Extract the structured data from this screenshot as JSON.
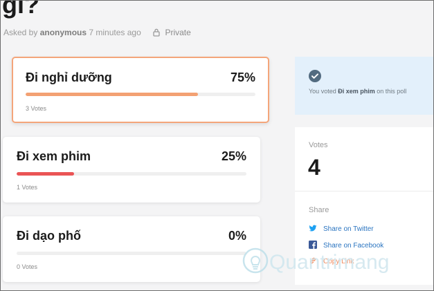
{
  "question": {
    "title": "gì?"
  },
  "meta": {
    "asked_prefix": "Asked by ",
    "author": "anonymous",
    "time": "7 minutes ago",
    "privacy": "Private"
  },
  "options": [
    {
      "label": "Đi nghỉ dưỡng",
      "percent_text": "75%",
      "percent": 75,
      "votes_text": "3 Votes",
      "bar_color": "#f3a173",
      "selected": true
    },
    {
      "label": "Đi xem phim",
      "percent_text": "25%",
      "percent": 25,
      "votes_text": "1 Votes",
      "bar_color": "#ea5455",
      "selected": false
    },
    {
      "label": "Đi dạo phố",
      "percent_text": "0%",
      "percent": 0,
      "votes_text": "0 Votes",
      "bar_color": "#efefef",
      "selected": false
    }
  ],
  "voted": {
    "prefix": "You voted ",
    "choice": "Đi xem phim",
    "suffix": " on this poll"
  },
  "stats": {
    "votes_label": "Votes",
    "votes_count": "4"
  },
  "share": {
    "label": "Share",
    "twitter": "Share on Twitter",
    "facebook": "Share on Facebook",
    "copy": "Copy Link"
  },
  "watermark": {
    "text": "Quantrimang"
  }
}
